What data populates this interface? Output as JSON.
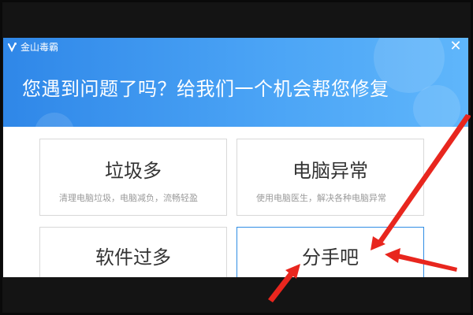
{
  "app": {
    "title": "金山毒霸",
    "close_glyph": "✕"
  },
  "header": {
    "headline": "您遇到问题了吗？给我们一个机会帮您修复"
  },
  "cards": [
    {
      "title": "垃圾多",
      "desc": "清理电脑垃圾，电脑减负，流畅轻盈"
    },
    {
      "title": "电脑异常",
      "desc": "使用电脑医生，解决各种电脑异常"
    },
    {
      "title": "软件过多",
      "desc": ""
    },
    {
      "title": "分手吧",
      "desc": ""
    }
  ],
  "colors": {
    "header_start": "#2f87e8",
    "header_end": "#5fb6fb",
    "annotation_arrow": "#e8261e",
    "selected_border": "#2f8de4"
  },
  "icons": {
    "logo": "kingsoft-logo-icon",
    "close": "close-icon"
  }
}
